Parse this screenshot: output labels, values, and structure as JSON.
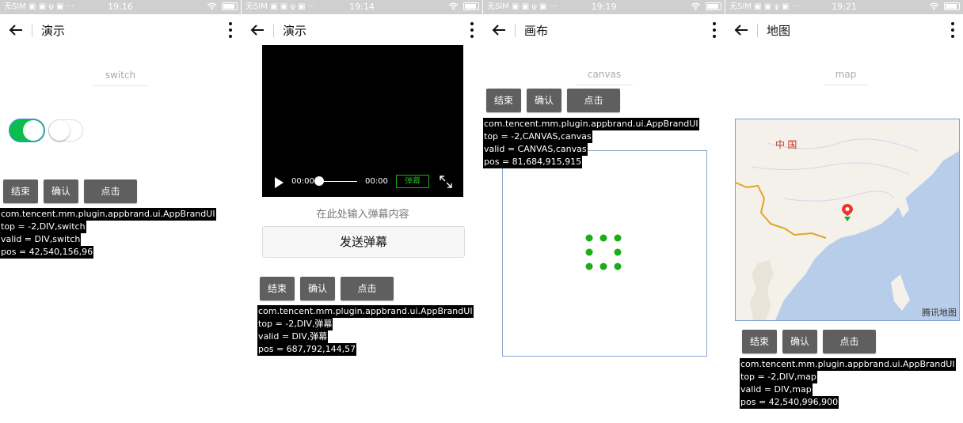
{
  "statusbar": {
    "carrier": "无SIM ▣ ▣ ψ ▣ ···",
    "times": [
      "19:16",
      "19:14",
      "19:19",
      "19:21"
    ]
  },
  "icons": {
    "back": "back-arrow-icon",
    "more": "more-vertical-icon",
    "wifi": "wifi-icon",
    "battery": "battery-icon",
    "play": "play-icon",
    "fullscreen": "fullscreen-icon",
    "loading": "loading-dots-icon",
    "map_marker": "map-marker-icon"
  },
  "colors": {
    "switch_on": "#0cbc4d",
    "button_bg": "#5f5f5f",
    "danmu_toggle": "#1aad19",
    "loading_dots": "#1aad19",
    "map_water": "#b8cdea",
    "map_land": "#f4f1ea"
  },
  "buttons": {
    "end": "结束",
    "confirm": "确认",
    "click": "点击"
  },
  "panels": [
    {
      "title": "演示",
      "field_label": "switch",
      "switches": [
        true,
        false
      ],
      "info": {
        "class_name": "com.tencent.mm.plugin.appbrand.ui.AppBrandUI",
        "top": "top = -2,DIV,switch",
        "valid": "valid = DIV,switch",
        "pos": "pos = 42,540,156,96"
      }
    },
    {
      "title": "演示",
      "video": {
        "current_time": "00:00",
        "duration": "00:00",
        "danmu_button": "弹幕",
        "progress": 0
      },
      "danmu_placeholder": "在此处输入弹幕内容",
      "send_button": "发送弹幕",
      "info": {
        "class_name": "com.tencent.mm.plugin.appbrand.ui.AppBrandUI",
        "top": "top = -2,DIV,弹幕",
        "valid": "valid = DIV,弹幕",
        "pos": "pos = 687,792,144,57"
      }
    },
    {
      "title": "画布",
      "field_label": "canvas",
      "info": {
        "class_name": "com.tencent.mm.plugin.appbrand.ui.AppBrandUI",
        "top": "top = -2,CANVAS,canvas",
        "valid": "valid = CANVAS,canvas",
        "pos": "pos = 81,684,915,915"
      }
    },
    {
      "title": "地图",
      "field_label": "map",
      "map": {
        "country_label": "中 国",
        "copyright": "腾讯地图"
      },
      "info": {
        "class_name": "com.tencent.mm.plugin.appbrand.ui.AppBrandUI",
        "top": "top = -2,DIV,map",
        "valid": "valid = DIV,map",
        "pos": "pos = 42,540,996,900"
      }
    }
  ]
}
